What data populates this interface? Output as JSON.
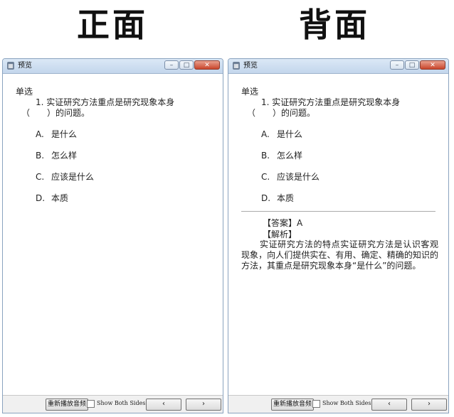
{
  "headings": {
    "front": "正面",
    "back": "背面"
  },
  "window_title": "预览",
  "question": {
    "type": "单选",
    "stem_line1": "1. 实证研究方法重点是研究现象本身",
    "stem_line2": "（　　）的问题。",
    "options": [
      {
        "letter": "A.",
        "text": "是什么"
      },
      {
        "letter": "B.",
        "text": "怎么样"
      },
      {
        "letter": "C.",
        "text": "应该是什么"
      },
      {
        "letter": "D.",
        "text": "本质"
      }
    ]
  },
  "answer": {
    "answer_line": "【答案】A",
    "analysis_label": "【解析】",
    "analysis_text": "实证研究方法的特点实证研究方法是认识客观现象，向人们提供实在、有用、确定、精确的知识的方法，其重点是研究现象本身“是什么”的问题。"
  },
  "bottom": {
    "replay_label": "重新播放音频",
    "show_both_label": "Show Both Sides",
    "prev_label": "‹",
    "next_label": "›"
  },
  "window_controls": {
    "minimize": "–",
    "maximize": "□",
    "close": "✕"
  }
}
